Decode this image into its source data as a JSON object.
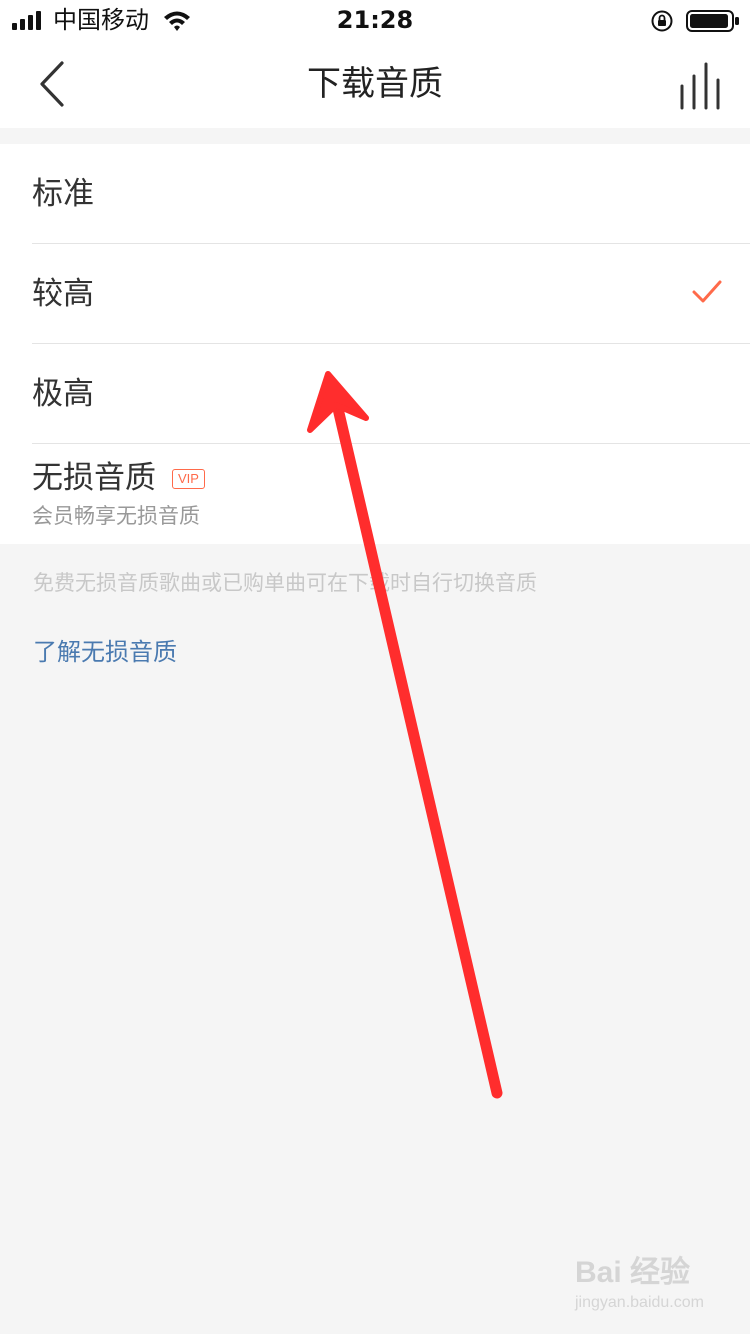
{
  "status_bar": {
    "carrier": "中国移动",
    "time": "21:28"
  },
  "nav": {
    "title": "下载音质"
  },
  "options": [
    {
      "label": "标准",
      "selected": false
    },
    {
      "label": "较高",
      "selected": true
    },
    {
      "label": "极高",
      "selected": false
    },
    {
      "label": "无损音质",
      "badge": "VIP",
      "subtitle": "会员畅享无损音质",
      "selected": false
    }
  ],
  "footnote": "免费无损音质歌曲或已购单曲可在下载时自行切换音质",
  "learn_link": "了解无损音质",
  "watermark": {
    "main": "Bai 经验",
    "sub": "jingyan.baidu.com"
  },
  "colors": {
    "accent": "#ff6a4a",
    "link": "#4a7ab0",
    "annotation_arrow": "#ff2d2d"
  }
}
